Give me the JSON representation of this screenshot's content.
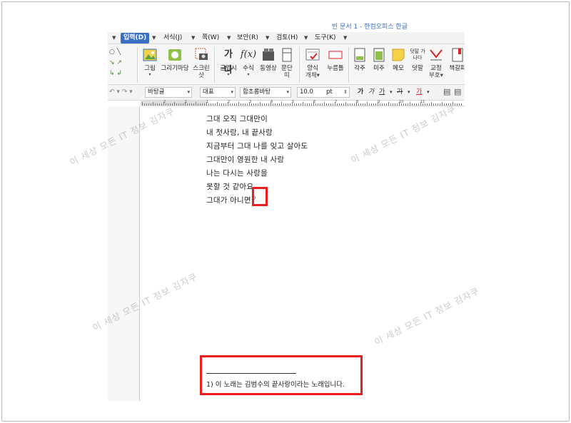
{
  "window": {
    "title": "빈 문서 1 - 한컴오피스 한글"
  },
  "menubar": {
    "items": [
      "입력(D)",
      "서식(J)",
      "쪽(W)",
      "보안(R)",
      "검토(H)",
      "도구(K)"
    ],
    "active": "입력(D)"
  },
  "ribbon": {
    "left_group": {
      "row1": "○ ╲",
      "row2": "↘ ↗",
      "row3": "↳ ↲"
    },
    "buttons": [
      {
        "label": "그림",
        "sub": "▾"
      },
      {
        "label": "그리기마당",
        "sub": ""
      },
      {
        "label": "스크린",
        "sub": "샷"
      },
      {
        "label": "글맵시",
        "sub": "▾"
      },
      {
        "label": "수식",
        "sub": "▾"
      },
      {
        "label": "동영상",
        "sub": ""
      },
      {
        "label": "문단",
        "sub": "띠"
      },
      {
        "label": "양식",
        "sub": "개체▾"
      },
      {
        "label": "누름틀",
        "sub": ""
      },
      {
        "label": "각주",
        "sub": ""
      },
      {
        "label": "미주",
        "sub": ""
      },
      {
        "label": "메모",
        "sub": ""
      },
      {
        "label": "덧말",
        "sub": ""
      },
      {
        "label": "교정",
        "sub": "부호▾"
      },
      {
        "label": "책갈피",
        "sub": ""
      }
    ],
    "icon_text": {
      "gulmaesi": "가나",
      "formula": "f(x)",
      "dotmal": "덧말 가나다"
    }
  },
  "format_bar": {
    "style": "바탕글",
    "lang": "대표",
    "font": "함초롬바탕",
    "size": "10.0",
    "unit": "pt",
    "bold_glyph": "가",
    "italic_glyph": "가",
    "underline_glyph": "가",
    "strike_glyph": "가",
    "color_glyph": "가"
  },
  "ruler": {
    "numbers": [
      "2",
      "1",
      "1",
      "2",
      "3",
      "4",
      "5",
      "6",
      "7",
      "8",
      "9",
      "10",
      "11"
    ]
  },
  "document": {
    "lines": [
      "그대 오직 그대만이",
      "내 첫사랑, 내 끝사랑",
      "지금부터 그대 나를 잊고 살아도",
      "그대만이 영원한 내 사랑",
      "나는 다시는 사랑을",
      "못할 것 같아요",
      "그대가 아니면"
    ],
    "footnote_marker": "1)",
    "footnote_text": "1) 이 노래는 김범수의 끝사랑이라는 노래입니다."
  },
  "watermarks": [
    "이 세상 모든 IT 정보 김자쿠",
    "이 세상 모든 IT 정보 김자쿠",
    "이 세상 모든 IT 정보 김자쿠",
    "이 세상 모든 IT 정보 김자쿠"
  ],
  "colors": {
    "highlight": "#ee1c1c",
    "menu_active": "#3a6fc4",
    "title": "#3d6fbf"
  }
}
